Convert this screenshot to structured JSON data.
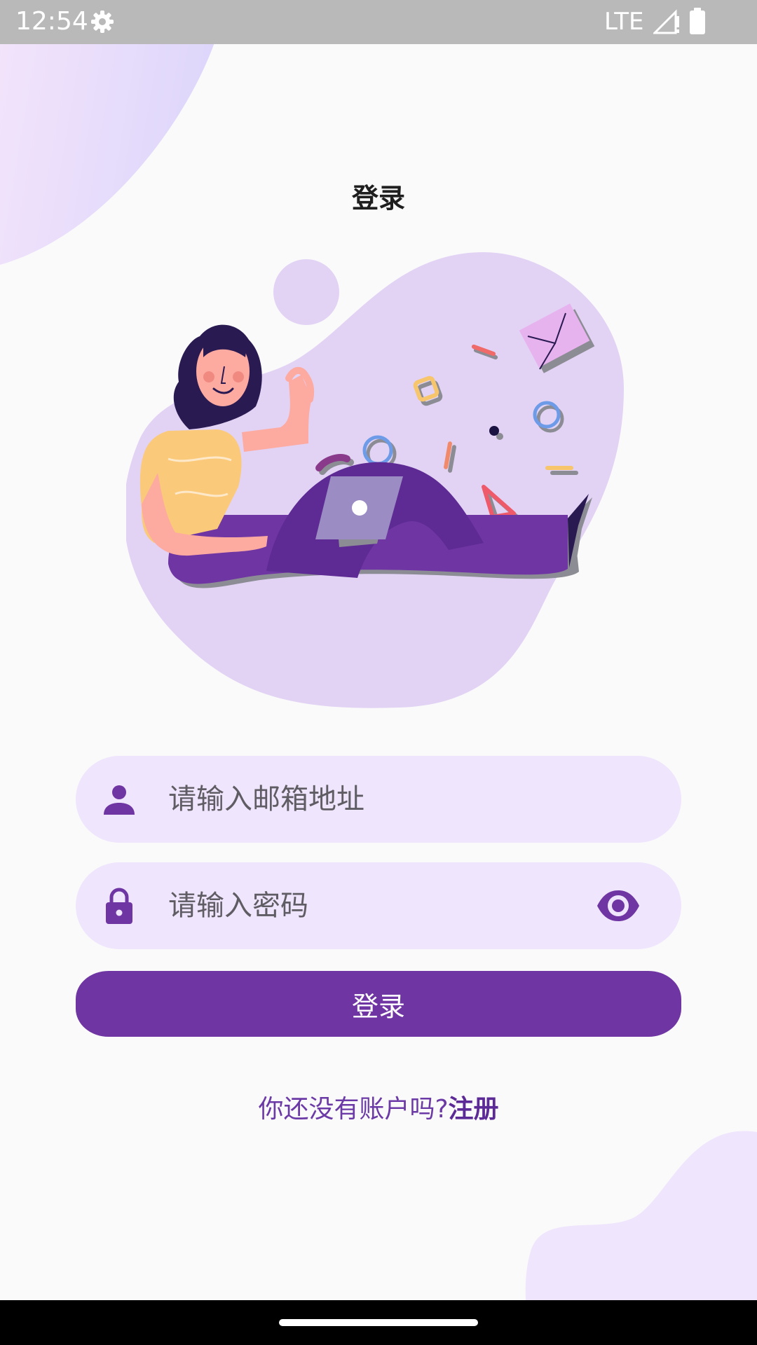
{
  "status_bar": {
    "time": "12:54",
    "network": "LTE"
  },
  "login": {
    "title": "登录",
    "email_placeholder": "请输入邮箱地址",
    "password_placeholder": "请输入密码",
    "submit_label": "登录",
    "signup_prompt": "你还没有账户吗?",
    "signup_link": "注册"
  },
  "icons": {
    "status": [
      "gear-icon",
      "signal-icon",
      "battery-icon"
    ],
    "email_field": "person-icon",
    "password_field": "lock-icon",
    "password_toggle": "eye-icon"
  },
  "colors": {
    "primary": "#6e35a3",
    "field_background": "#efe5fd",
    "illustration_blob": "#e2d3f5",
    "status_bar": "#b9b9b9"
  }
}
